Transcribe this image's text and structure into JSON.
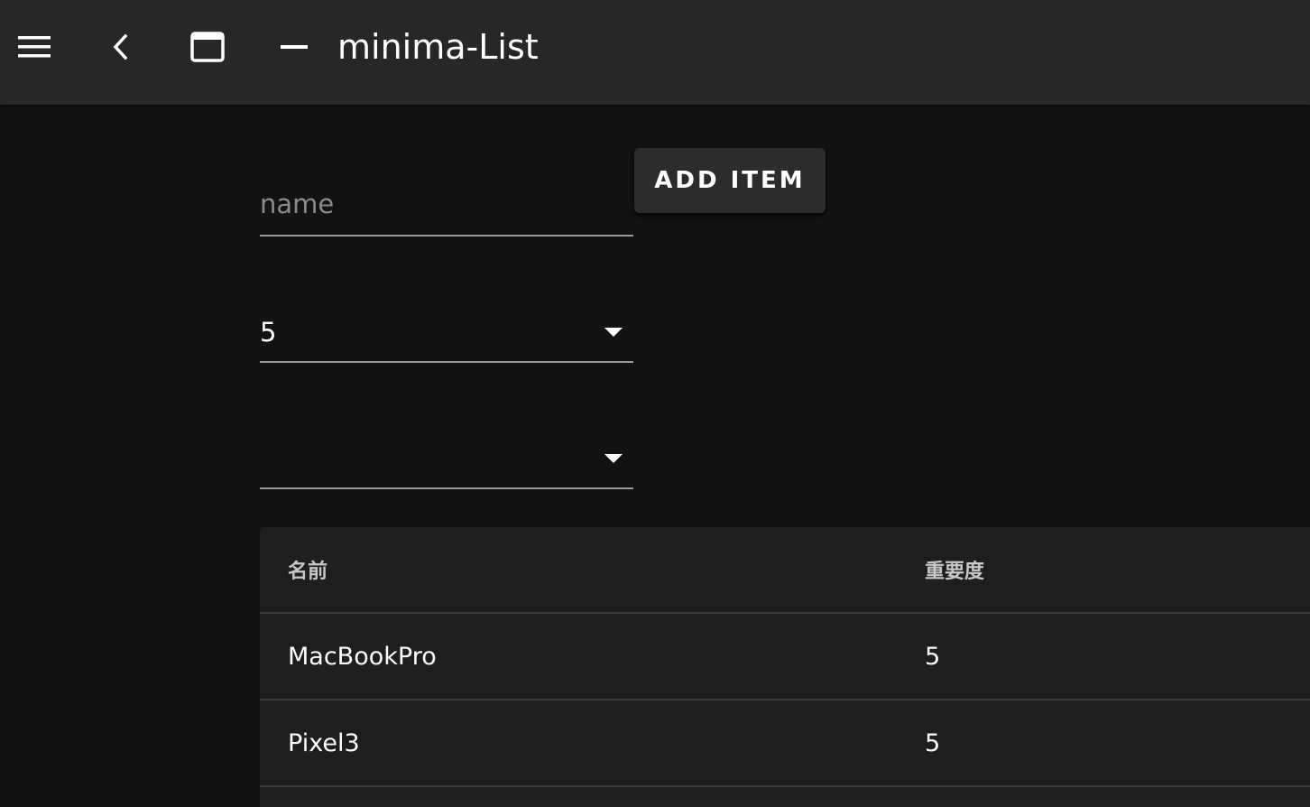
{
  "app": {
    "title": "minima-List"
  },
  "toolbar": {
    "menu_icon": "hamburger-menu-icon",
    "back_icon": "chevron-left-icon",
    "window_icon": "window-maximize-icon",
    "minimize_icon": "minimize-icon"
  },
  "form": {
    "name_placeholder": "name",
    "name_value": "",
    "importance_value": "5",
    "second_select_value": "",
    "add_button_label": "ADD ITEM"
  },
  "table": {
    "headers": [
      "名前",
      "重要度"
    ],
    "rows": [
      {
        "name": "MacBookPro",
        "importance": "5"
      },
      {
        "name": "Pixel3",
        "importance": "5"
      }
    ]
  },
  "colors": {
    "background": "#121212",
    "appbar": "#272727",
    "card": "#1e1e1e",
    "button": "#2c2c2c"
  }
}
